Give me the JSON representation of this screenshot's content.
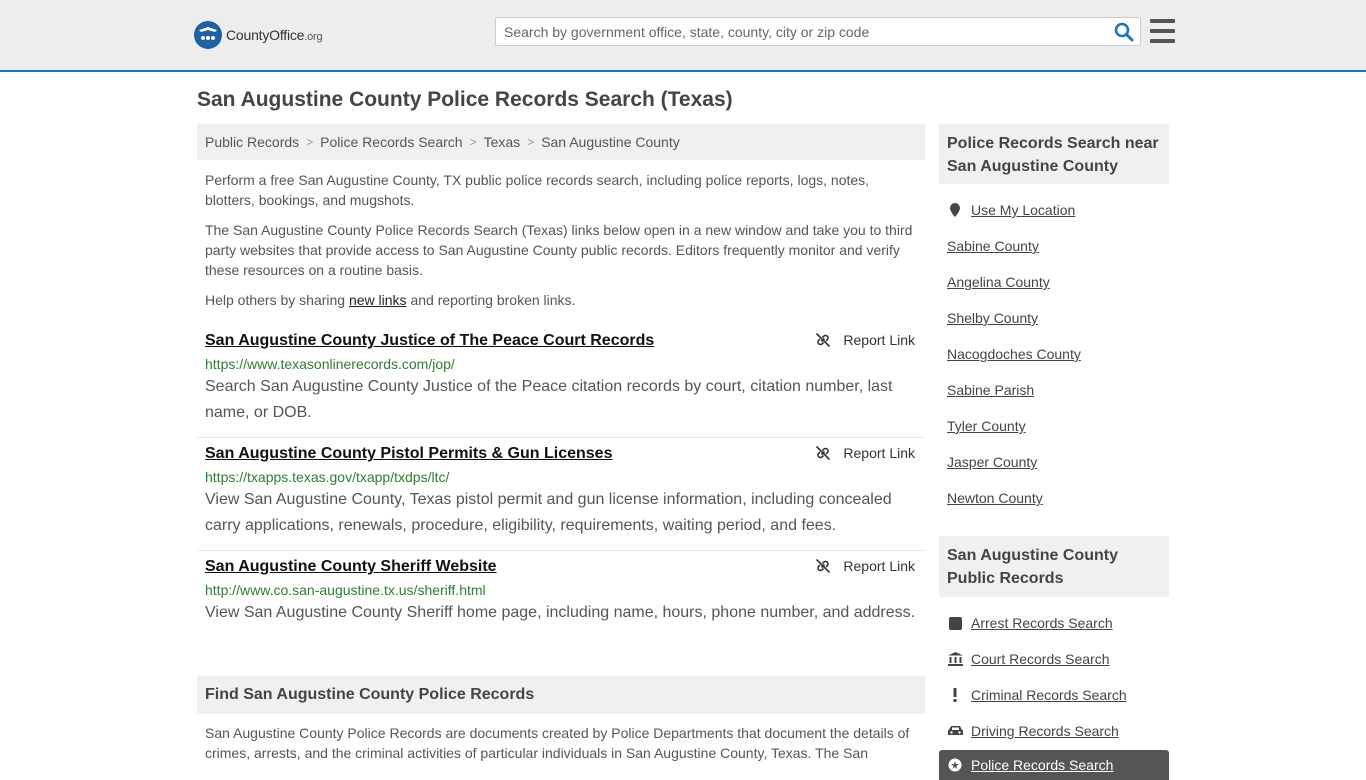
{
  "header": {
    "logo_main": "CountyOffice",
    "logo_suffix": ".org",
    "search_placeholder": "Search by government office, state, county, city or zip code"
  },
  "page": {
    "title": "San Augustine County Police Records Search (Texas)"
  },
  "breadcrumb": [
    "Public Records",
    "Police Records Search",
    "Texas",
    "San Augustine County"
  ],
  "intro": {
    "p1": "Perform a free San Augustine County, TX public police records search, including police reports, logs, notes, blotters, bookings, and mugshots.",
    "p2": "The San Augustine County Police Records Search (Texas) links below open in a new window and take you to third party websites that provide access to San Augustine County public records. Editors frequently monitor and verify these resources on a routine basis.",
    "p3_before": "Help others by sharing ",
    "p3_link": "new links",
    "p3_after": " and reporting broken links."
  },
  "results": [
    {
      "title": "San Augustine County Justice of The Peace Court Records",
      "url": "https://www.texasonlinerecords.com/jop/",
      "description": "Search San Augustine County Justice of the Peace citation records by court, citation number, last name, or DOB.",
      "report_label": "Report Link"
    },
    {
      "title": "San Augustine County Pistol Permits & Gun Licenses",
      "url": "https://txapps.texas.gov/txapp/txdps/ltc/",
      "description": "View San Augustine County, Texas pistol permit and gun license information, including concealed carry applications, renewals, procedure, eligibility, requirements, waiting period, and fees.",
      "report_label": "Report Link"
    },
    {
      "title": "San Augustine County Sheriff Website",
      "url": "http://www.co.san-augustine.tx.us/sheriff.html",
      "description": "View San Augustine County Sheriff home page, including name, hours, phone number, and address.",
      "report_label": "Report Link"
    }
  ],
  "find": {
    "heading": "Find San Augustine County Police Records",
    "text": "San Augustine County Police Records are documents created by Police Departments that document the details of crimes, arrests, and the criminal activities of particular individuals in San Augustine County, Texas. The San"
  },
  "sidebar": {
    "nearby_heading": "Police Records Search near San Augustine County",
    "use_location": "Use My Location",
    "nearby": [
      "Sabine County",
      "Angelina County",
      "Shelby County",
      "Nacogdoches County",
      "Sabine Parish",
      "Tyler County",
      "Jasper County",
      "Newton County"
    ],
    "public_heading": "San Augustine County Public Records",
    "public_links": [
      {
        "label": "Arrest Records Search",
        "icon": "square-icon"
      },
      {
        "label": "Court Records Search",
        "icon": "courthouse-icon"
      },
      {
        "label": "Criminal Records Search",
        "icon": "exclamation-icon"
      },
      {
        "label": "Driving Records Search",
        "icon": "car-icon"
      },
      {
        "label": "Police Records Search",
        "icon": "police-badge-icon"
      }
    ]
  },
  "colors": {
    "accent": "#1b75bb",
    "url_green": "#2e7d32",
    "header_bg": "#ededed",
    "box_bg": "#f0f0f0",
    "active_bg": "#555555"
  }
}
